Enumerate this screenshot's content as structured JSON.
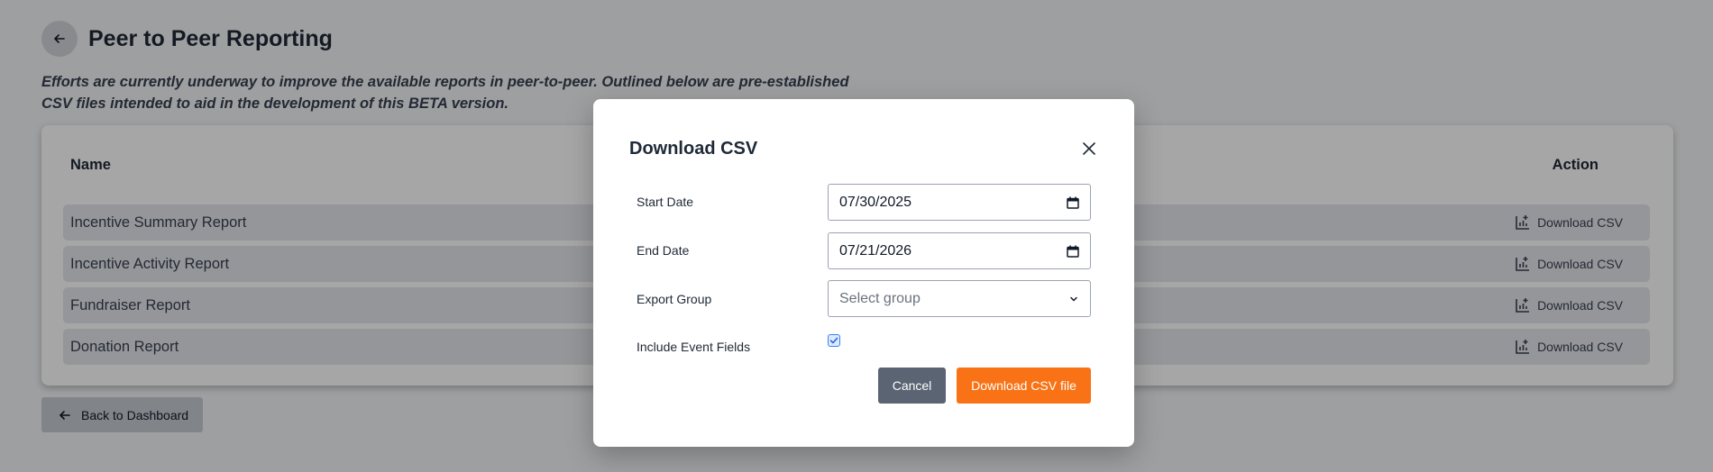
{
  "page": {
    "title": "Peer to Peer Reporting",
    "intro_line1": "Efforts are currently underway to improve the available reports in peer-to-peer. Outlined below are pre-established",
    "intro_line2": "CSV files intended to aid in the development of this BETA version.",
    "back_to_dashboard": "Back to Dashboard"
  },
  "table": {
    "col_name": "Name",
    "col_action": "Action",
    "rows": [
      {
        "name": "Incentive Summary Report",
        "action": "Download CSV"
      },
      {
        "name": "Incentive Activity Report",
        "action": "Download CSV"
      },
      {
        "name": "Fundraiser Report",
        "action": "Download CSV"
      },
      {
        "name": "Donation Report",
        "action": "Download CSV"
      }
    ]
  },
  "modal": {
    "title": "Download CSV",
    "start_date_label": "Start Date",
    "start_date_value": "07/30/2025",
    "end_date_label": "End Date",
    "end_date_value": "07/21/2026",
    "export_group_label": "Export Group",
    "export_group_placeholder": "Select group",
    "include_event_fields_label": "Include Event Fields",
    "include_event_fields_checked": true,
    "cancel_label": "Cancel",
    "download_label": "Download CSV file"
  },
  "colors": {
    "accent": "#f97316",
    "cancel": "#5b6472",
    "checkbox": "#3b82f6"
  },
  "icons": [
    "arrow-left-icon",
    "csv-chart-icon",
    "close-icon",
    "calendar-icon",
    "chevron-down-icon",
    "check-icon"
  ]
}
